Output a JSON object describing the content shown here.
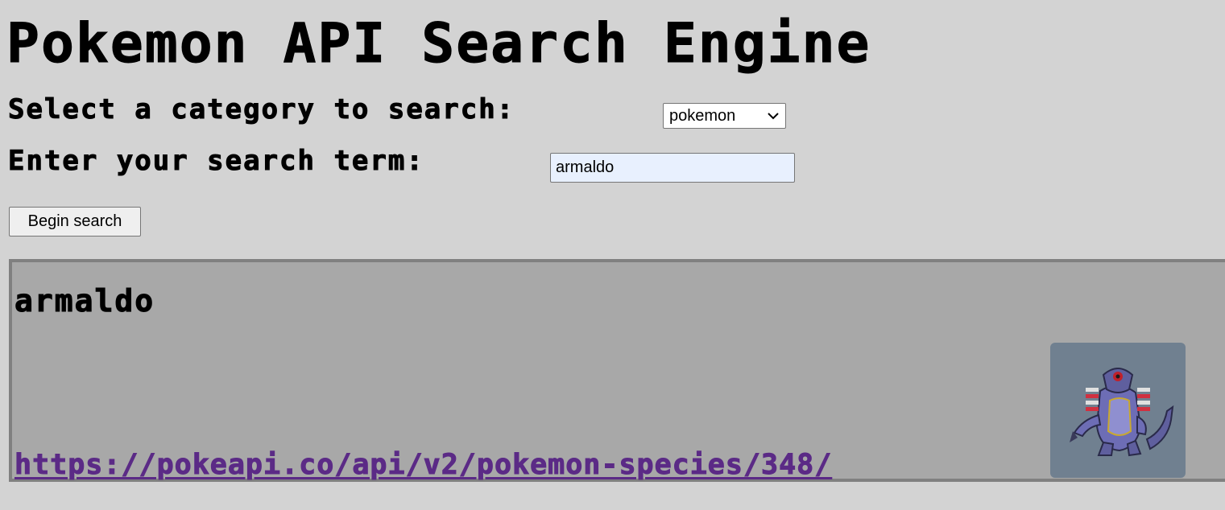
{
  "header": {
    "title": "Pokemon API Search Engine"
  },
  "form": {
    "category_label": "Select a category to search:",
    "category_selected": "pokemon",
    "term_label": "Enter your search term:",
    "search_value": "armaldo",
    "submit_label": "Begin search"
  },
  "result": {
    "name": "armaldo",
    "species_url": "https://pokeapi.co/api/v2/pokemon-species/348/",
    "sprite_icon": "armaldo-sprite-icon"
  },
  "colors": {
    "page_background": "#d3d3d3",
    "card_background": "#a8a8a8",
    "card_border": "#808080",
    "sprite_background": "#708090",
    "link": "#5b2a86",
    "input_autofill": "#e8f0fe"
  }
}
